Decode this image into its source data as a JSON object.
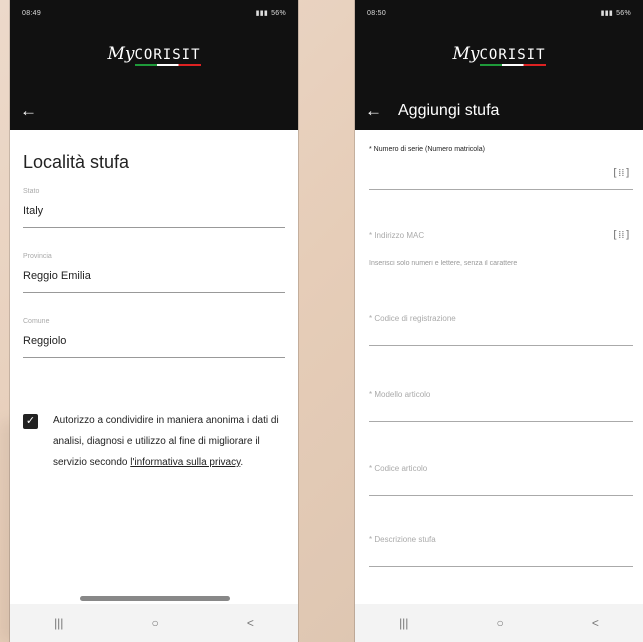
{
  "left": {
    "status": {
      "time": "08:49",
      "right": "56%"
    },
    "logo": {
      "my": "My",
      "brand": "CORISIT"
    },
    "title": "Località stufa",
    "fields": [
      {
        "label": "Stato",
        "value": "Italy"
      },
      {
        "label": "Provincia",
        "value": "Reggio Emilia"
      },
      {
        "label": "Comune",
        "value": "Reggiolo"
      }
    ],
    "consent": {
      "checked": true,
      "text": "Autorizzo a condividire in maniera anonima i dati di analisi, diagnosi e utilizzo al fine di migliorare il servizio secondo ",
      "link": "l'informativa sulla privacy",
      "end": "."
    }
  },
  "right": {
    "status": {
      "time": "08:50",
      "right": "56%"
    },
    "logo": {
      "my": "My",
      "brand": "CORISIT"
    },
    "title": "Aggiungi stufa",
    "fields": {
      "serial": "* Numero di serie (Numero matricola)",
      "mac": "* Indirizzo MAC",
      "mac_hint": "Inserisci solo numeri e lettere, senza il carattere",
      "reg": "* Codice di registrazione",
      "model": "* Modello articolo",
      "code": "* Codice articolo",
      "desc": "* Descrizione stufa"
    }
  },
  "nav": {
    "recent": "|||",
    "home": "○",
    "back": "<"
  },
  "icons": {
    "back": "←",
    "scan": "[⁞⁞]",
    "check": "✓"
  }
}
